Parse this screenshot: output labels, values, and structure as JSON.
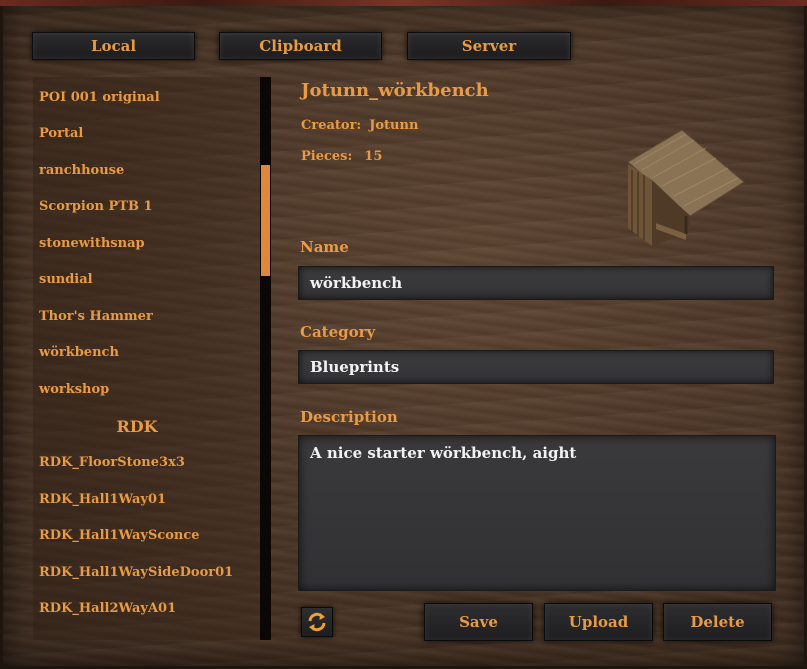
{
  "tabs": [
    {
      "label": "Local"
    },
    {
      "label": "Clipboard"
    },
    {
      "label": "Server"
    }
  ],
  "list": {
    "items": [
      "POI 001 original",
      "Portal",
      "ranchhouse",
      "Scorpion PTB 1",
      "stonewithsnap",
      "sundial",
      "Thor's Hammer",
      "wörkbench",
      "workshop"
    ],
    "section_header": "RDK",
    "section_items": [
      "RDK_FloorStone3x3",
      "RDK_Hall1Way01",
      "RDK_Hall1WaySconce",
      "RDK_Hall1WaySideDoor01",
      "RDK_Hall2WayA01"
    ],
    "scroll_position": 0.2
  },
  "detail": {
    "title": "Jotunn_wörkbench",
    "creator_label": "Creator:",
    "creator_value": "Jotunn",
    "pieces_label": "Pieces:",
    "pieces_value": "15",
    "name_label": "Name",
    "name_value": "wörkbench",
    "category_label": "Category",
    "category_value": "Blueprints",
    "description_label": "Description",
    "description_value": "A nice starter wörkbench, aight"
  },
  "buttons": {
    "refresh_icon": "refresh-icon",
    "save": "Save",
    "upload": "Upload",
    "delete": "Delete"
  },
  "colors": {
    "accent": "#e89a45",
    "field_bg": "#363638",
    "scroll_thumb": "#e0883a"
  }
}
